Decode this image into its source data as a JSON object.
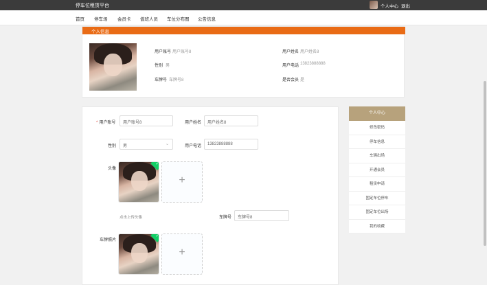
{
  "topbar": {
    "brand": "停车位租赁平台",
    "user_center": "个人中心",
    "logout": "退出"
  },
  "nav": [
    "首页",
    "停车场",
    "会员卡",
    "值班人员",
    "车位分布图",
    "公告信息"
  ],
  "profile_card": {
    "title": "个人信息",
    "fields": {
      "account_label": "用户账号",
      "account_value": "用户账号8",
      "name_label": "用户姓名",
      "name_value": "用户姓名8",
      "gender_label": "性别",
      "gender_value": "男",
      "phone_label": "用户电话",
      "phone_value": "13823888888",
      "plate_label": "车牌号",
      "plate_value": "车牌号8",
      "vip_label": "是否会员",
      "vip_value": "是"
    }
  },
  "form": {
    "account_label": "用户账号",
    "account_value": "用户账号8",
    "name_label": "用户姓名",
    "name_value": "用户姓名8",
    "gender_label": "性别",
    "gender_value": "男",
    "phone_label": "用户电话",
    "phone_value": "13823888888",
    "avatar_label": "头像",
    "avatar_tip": "点击上传头像",
    "plate_label": "车牌号",
    "plate_value": "车牌号8",
    "plate_photo_label": "车牌照片",
    "upload_plus": "+",
    "check": "✓",
    "chevron": "⌄"
  },
  "sidebar": {
    "header": "个人中心",
    "items": [
      "修改密码",
      "停车信息",
      "车辆出场",
      "开通会员",
      "租赁申请",
      "固定车位停车",
      "固定车位出场",
      "我的收藏"
    ]
  }
}
